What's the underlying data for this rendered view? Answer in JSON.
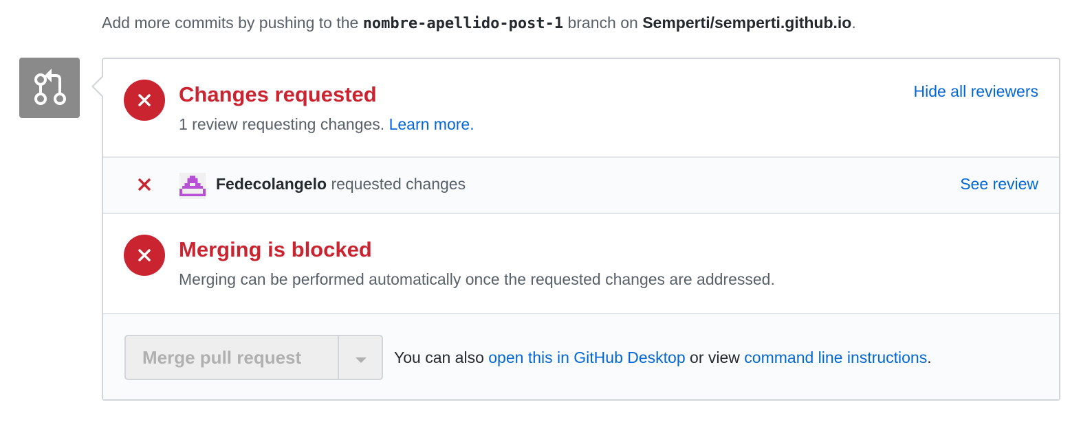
{
  "top_notice": {
    "prefix": "Add more commits by pushing to the",
    "branch": "nombre-apellido-post-1",
    "middle": "branch on",
    "repo": "Semperti/semperti.github.io",
    "suffix": "."
  },
  "changes_requested": {
    "title": "Changes requested",
    "description": "1 review requesting changes.",
    "learn_more": "Learn more.",
    "hide_reviewers": "Hide all reviewers"
  },
  "reviewer": {
    "name": "Fedecolangelo",
    "action": "requested changes",
    "see_review": "See review"
  },
  "blocked": {
    "title": "Merging is blocked",
    "description": "Merging can be performed automatically once the requested changes are addressed."
  },
  "merge": {
    "button_label": "Merge pull request",
    "help_prefix": "You can also",
    "desktop_link": "open this in GitHub Desktop",
    "help_middle": "or view",
    "cli_link": "command line instructions",
    "help_suffix": "."
  },
  "icons": {
    "timeline": "git-pull-request-icon",
    "status": "x-circle-icon",
    "reviewer_status": "x-icon",
    "dropdown": "triangle-down-icon"
  },
  "colors": {
    "error_red": "#cb2431",
    "link_blue": "#0366d6",
    "avatar_purple": "#b64fd6",
    "icon_gray": "#8a8a8a"
  }
}
